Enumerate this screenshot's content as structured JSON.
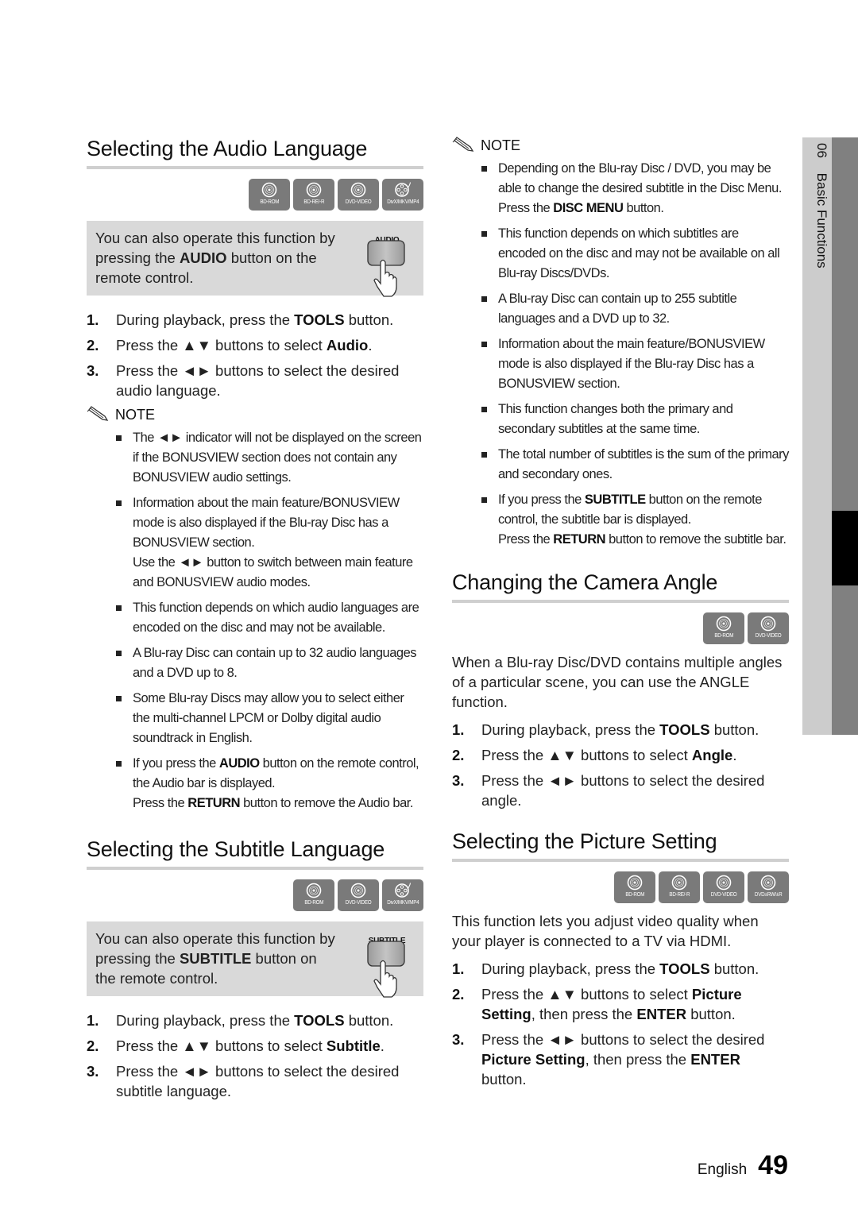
{
  "side_tab": {
    "chapter_number": "06",
    "chapter_title": "Basic Functions"
  },
  "footer": {
    "language": "English",
    "page_number": "49"
  },
  "icons": {
    "disc": "disc-icon",
    "film_reel": "film-reel-icon",
    "pencil": "pencil-note-icon",
    "remote_button": "remote-button-hand-icon"
  },
  "left": {
    "audio": {
      "title": "Selecting the Audio Language",
      "badges": [
        "BD-ROM",
        "BD-RE/-R",
        "DVD-VIDEO",
        "DivX/MKV/MP4"
      ],
      "info_pre": "You can also operate this function by pressing the ",
      "info_bold": "AUDIO",
      "info_post": " button on the remote control.",
      "remote_label": "AUDIO",
      "steps": [
        {
          "num": "1.",
          "pre": "During playback, press the ",
          "bold": "TOOLS",
          "post": " button."
        },
        {
          "num": "2.",
          "pre": "Press the ▲▼ buttons to select ",
          "bold": "Audio",
          "post": "."
        },
        {
          "num": "3.",
          "pre": "Press the ◄► buttons to select the desired audio language.",
          "bold": "",
          "post": ""
        }
      ],
      "note_label": "NOTE",
      "notes": [
        {
          "pre": "The ◄► indicator will not be displayed on the screen if the BONUSVIEW section does not contain any BONUSVIEW audio settings.",
          "bold": "",
          "post": "",
          "extra": ""
        },
        {
          "pre": "Information about the main feature/BONUSVIEW mode is also displayed if the Blu-ray Disc has a BONUSVIEW section.",
          "bold": "",
          "post": "",
          "extra": "Use the ◄► button to switch between main feature and BONUSVIEW audio modes."
        },
        {
          "pre": "This function depends on which audio languages are encoded on the disc and may not be available.",
          "bold": "",
          "post": "",
          "extra": ""
        },
        {
          "pre": "A Blu-ray Disc can contain up to 32 audio languages and a DVD up to 8.",
          "bold": "",
          "post": "",
          "extra": ""
        },
        {
          "pre": "Some Blu-ray Discs may allow you to select either the multi-channel LPCM or Dolby digital audio soundtrack in English.",
          "bold": "",
          "post": "",
          "extra": ""
        },
        {
          "pre": "If you press the ",
          "bold": "AUDIO",
          "post": " button on the remote control, the Audio bar is displayed.",
          "extra_pre": "Press the ",
          "extra_bold": "RETURN",
          "extra_post": " button to remove the Audio bar."
        }
      ]
    },
    "subtitle": {
      "title": "Selecting the Subtitle Language",
      "badges": [
        "BD-ROM",
        "DVD-VIDEO",
        "DivX/MKV/MP4"
      ],
      "info_pre": "You can also operate this function by pressing the ",
      "info_bold": "SUBTITLE",
      "info_post": " button on the remote control.",
      "remote_label": "SUBTITLE",
      "steps": [
        {
          "num": "1.",
          "pre": "During playback, press the ",
          "bold": "TOOLS",
          "post": " button."
        },
        {
          "num": "2.",
          "pre": "Press the ▲▼ buttons to select ",
          "bold": "Subtitle",
          "post": "."
        },
        {
          "num": "3.",
          "pre": "Press the ◄► buttons to select the desired subtitle language.",
          "bold": "",
          "post": ""
        }
      ]
    }
  },
  "right": {
    "subtitle_notes": {
      "note_label": "NOTE",
      "notes": [
        {
          "pre": "Depending on the Blu-ray Disc / DVD, you may be able to change the desired subtitle in the Disc Menu.",
          "extra_pre": "Press the ",
          "extra_bold": "DISC MENU",
          "extra_post": " button."
        },
        {
          "pre": "This function depends on which subtitles are encoded on the disc and may not be available on all Blu-ray Discs/DVDs."
        },
        {
          "pre": "A Blu-ray Disc can contain up to 255 subtitle languages and a DVD up to 32."
        },
        {
          "pre": "Information about the main feature/BONUSVIEW mode is also displayed if the Blu-ray Disc has a BONUSVIEW section."
        },
        {
          "pre": "This function changes both the primary and secondary subtitles at the same time."
        },
        {
          "pre": "The total number of subtitles is the sum of the primary and secondary ones."
        },
        {
          "pre": "If you press the ",
          "bold": "SUBTITLE",
          "post": " button on the remote control, the subtitle bar is displayed.",
          "extra_pre": "Press the ",
          "extra_bold": "RETURN",
          "extra_post": " button to remove the subtitle bar."
        }
      ]
    },
    "angle": {
      "title": "Changing the Camera Angle",
      "badges": [
        "BD-ROM",
        "DVD-VIDEO"
      ],
      "intro": "When a Blu-ray Disc/DVD contains multiple angles of a particular scene, you can use the ANGLE function.",
      "steps": [
        {
          "num": "1.",
          "pre": "During playback, press the ",
          "bold": "TOOLS",
          "post": " button."
        },
        {
          "num": "2.",
          "pre": "Press the ▲▼ buttons to select ",
          "bold": "Angle",
          "post": "."
        },
        {
          "num": "3.",
          "pre": "Press the ◄► buttons to select the desired angle.",
          "bold": "",
          "post": ""
        }
      ]
    },
    "picture": {
      "title": "Selecting the Picture Setting",
      "badges": [
        "BD-ROM",
        "BD-RE/-R",
        "DVD-VIDEO",
        "DVD±RW/±R"
      ],
      "intro": "This function lets you adjust video quality when your player is connected to a TV via HDMI.",
      "steps": [
        {
          "num": "1.",
          "pre": "During playback, press the ",
          "bold": "TOOLS",
          "post": " button.",
          "bold2": "",
          "post2": ""
        },
        {
          "num": "2.",
          "pre": "Press the ▲▼ buttons to select ",
          "bold": "Picture Setting",
          "post": ", then press the ",
          "bold2": "ENTER",
          "post2": " button."
        },
        {
          "num": "3.",
          "pre": "Press the ◄► buttons to select the desired ",
          "bold": "Picture Setting",
          "post": ", then press the ",
          "bold2": "ENTER",
          "post2": " button."
        }
      ]
    }
  }
}
